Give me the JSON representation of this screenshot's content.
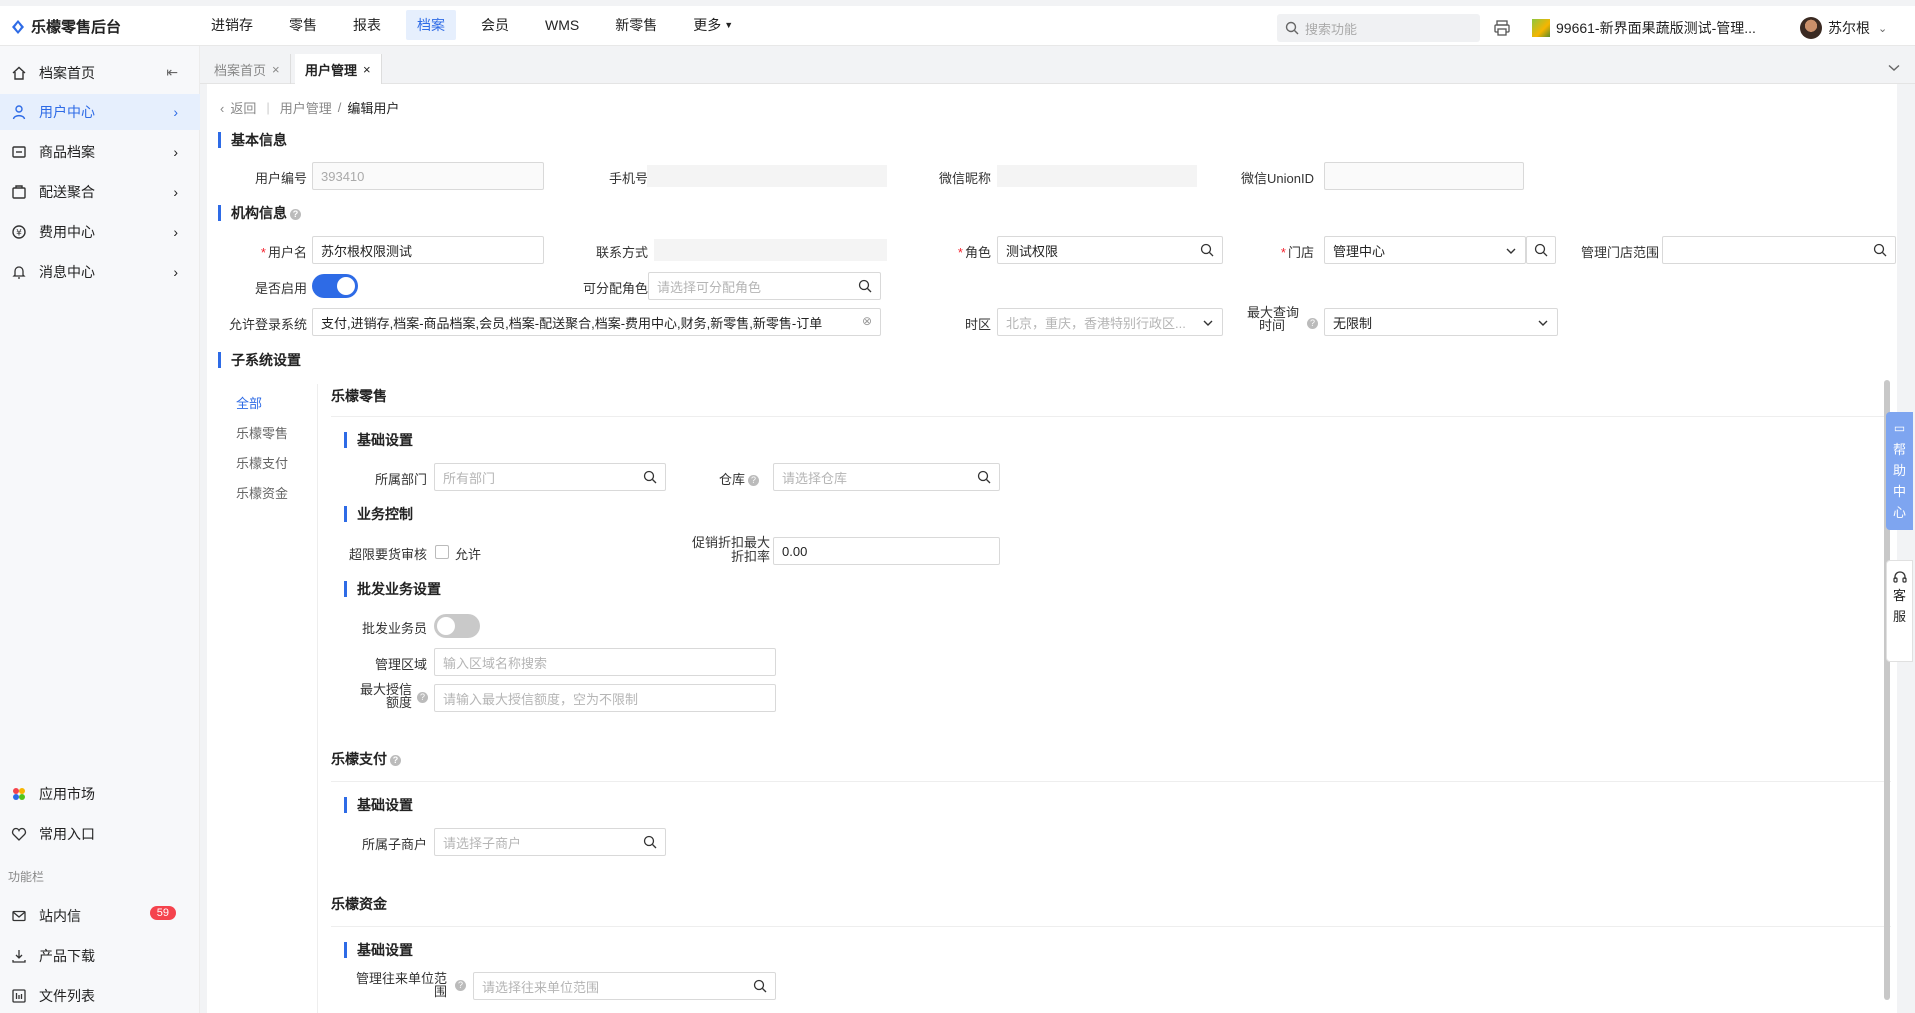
{
  "app": {
    "title": "乐檬零售后台"
  },
  "nav": {
    "items": [
      "进销存",
      "零售",
      "报表",
      "档案",
      "会员",
      "WMS",
      "新零售",
      "更多"
    ],
    "active_index": 3
  },
  "header": {
    "search_placeholder": "搜索功能",
    "store_name": "99661-新界面果蔬版测试-管理...",
    "user_name": "苏尔根"
  },
  "sidebar": {
    "items": [
      {
        "label": "档案首页",
        "icon": "home-icon"
      },
      {
        "label": "用户中心",
        "icon": "user-icon"
      },
      {
        "label": "商品档案",
        "icon": "goods-icon"
      },
      {
        "label": "配送聚合",
        "icon": "delivery-icon"
      },
      {
        "label": "费用中心",
        "icon": "money-icon"
      },
      {
        "label": "消息中心",
        "icon": "bell-icon"
      }
    ],
    "bottom": {
      "app_market": "应用市场",
      "favorites": "常用入口",
      "section_label": "功能栏",
      "messages": "站内信",
      "messages_badge": "59",
      "downloads": "产品下载",
      "files": "文件列表"
    }
  },
  "tabs": [
    {
      "label": "档案首页",
      "close": "×"
    },
    {
      "label": "用户管理",
      "close": "×"
    }
  ],
  "breadcrumb": {
    "back": "返回",
    "parent": "用户管理",
    "sep": "/",
    "current": "编辑用户"
  },
  "basic": {
    "title": "基本信息",
    "user_no_label": "用户编号",
    "user_no_value": "393410",
    "phone_label": "手机号",
    "wechat_nick_label": "微信昵称",
    "wechat_union_label": "微信UnionID"
  },
  "org": {
    "title": "机构信息",
    "username_label": "用户名",
    "username_value": "苏尔根权限测试",
    "contact_label": "联系方式",
    "role_label": "角色",
    "role_value": "测试权限",
    "store_label": "门店",
    "store_value": "管理中心",
    "manage_scope_label": "管理门店范围",
    "enabled_label": "是否启用",
    "assignable_role_label": "可分配角色",
    "assignable_role_placeholder": "请选择可分配角色",
    "login_systems_label": "允许登录系统",
    "login_systems_value": "支付,进销存,档案-商品档案,会员,档案-配送聚合,档案-费用中心,财务,新零售,新零售-订单",
    "timezone_label": "时区",
    "timezone_placeholder": "北京，重庆，香港特别行政区...",
    "max_query_label_1": "最大查询",
    "max_query_label_2": "时间",
    "max_query_value": "无限制"
  },
  "subsystem": {
    "title": "子系统设置",
    "nav": [
      "全部",
      "乐檬零售",
      "乐檬支付",
      "乐檬资金"
    ],
    "retail": {
      "title": "乐檬零售",
      "basic_title": "基础设置",
      "dept_label": "所属部门",
      "dept_placeholder": "所有部门",
      "warehouse_label": "仓库",
      "warehouse_placeholder": "请选择仓库",
      "biz_title": "业务控制",
      "over_limit_label": "超限要货审核",
      "allow_label": "允许",
      "discount_label_1": "促销折扣最大",
      "discount_label_2": "折扣率",
      "discount_value": "0.00",
      "wholesale_title": "批发业务设置",
      "wholesale_staff_label": "批发业务员",
      "area_label": "管理区域",
      "area_placeholder": "输入区域名称搜索",
      "credit_label_1": "最大授信",
      "credit_label_2": "额度",
      "credit_placeholder": "请输入最大授信额度，空为不限制"
    },
    "pay": {
      "title": "乐檬支付",
      "basic_title": "基础设置",
      "merchant_label": "所属子商户",
      "merchant_placeholder": "请选择子商户"
    },
    "fund": {
      "title": "乐檬资金",
      "basic_title": "基础设置",
      "unit_label_1": "管理往来单位范",
      "unit_label_2": "围",
      "unit_placeholder": "请选择往来单位范围"
    }
  },
  "float": {
    "help_chars": [
      "帮",
      "助",
      "中",
      "心"
    ],
    "service_chars": [
      "客",
      "服"
    ]
  },
  "colors": {
    "accent": "#2e6be6",
    "badge": "#f5434d",
    "help_float": "#7ea5f0"
  }
}
